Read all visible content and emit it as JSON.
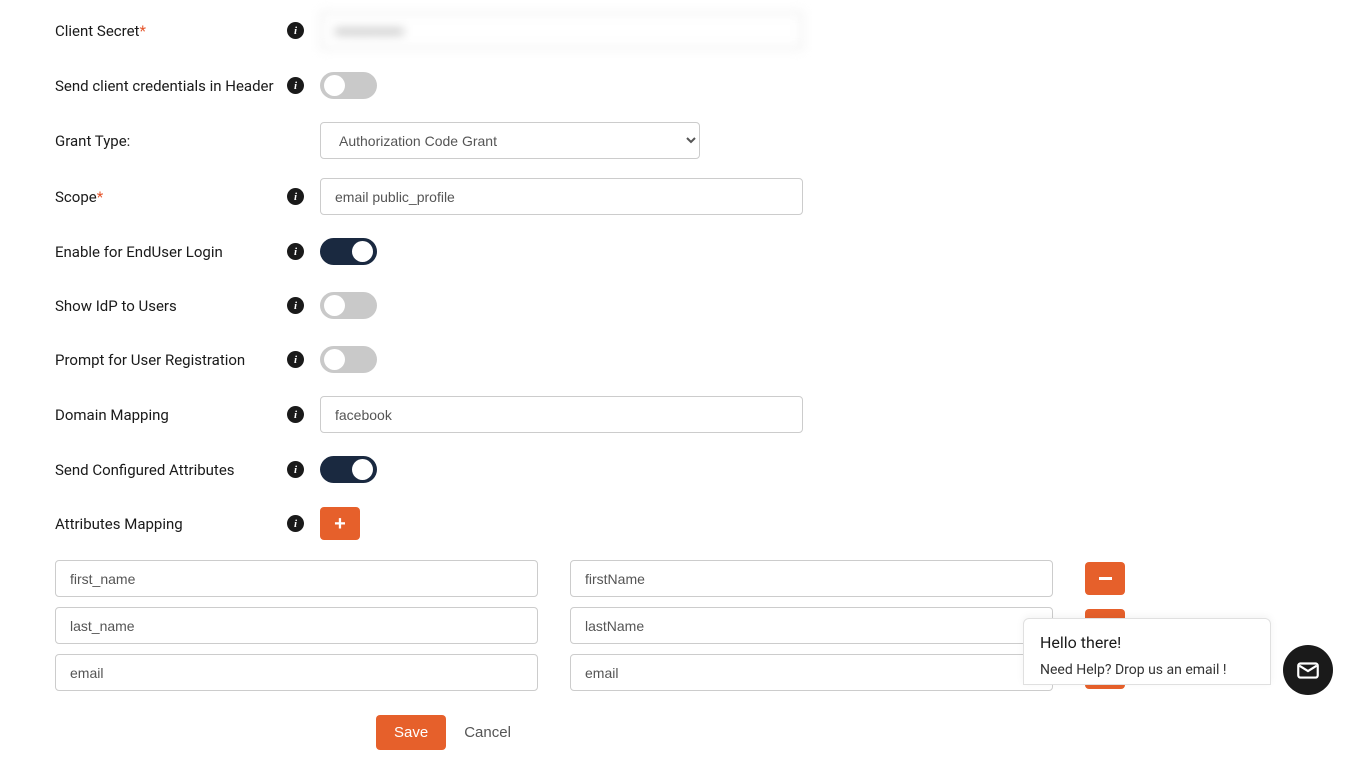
{
  "fields": {
    "client_secret": {
      "label": "Client Secret",
      "required": true,
      "value": "••••••••••••••"
    },
    "send_header": {
      "label": "Send client credentials in Header",
      "value": false
    },
    "grant_type": {
      "label": "Grant Type:",
      "selected": "Authorization Code Grant"
    },
    "scope": {
      "label": "Scope",
      "required": true,
      "value": "email public_profile"
    },
    "enable_enduser": {
      "label": "Enable for EndUser Login",
      "value": true
    },
    "show_idp": {
      "label": "Show IdP to Users",
      "value": false
    },
    "prompt_reg": {
      "label": "Prompt for User Registration",
      "value": false
    },
    "domain_mapping": {
      "label": "Domain Mapping",
      "value": "facebook"
    },
    "send_attr": {
      "label": "Send Configured Attributes",
      "value": true
    },
    "attr_mapping": {
      "label": "Attributes Mapping"
    }
  },
  "attribute_rows": [
    {
      "source": "first_name",
      "target": "firstName"
    },
    {
      "source": "last_name",
      "target": "lastName"
    },
    {
      "source": "email",
      "target": "email"
    }
  ],
  "buttons": {
    "save": "Save",
    "cancel": "Cancel"
  },
  "help": {
    "greeting": "Hello there!",
    "subtext": "Need Help? Drop us an email !"
  }
}
